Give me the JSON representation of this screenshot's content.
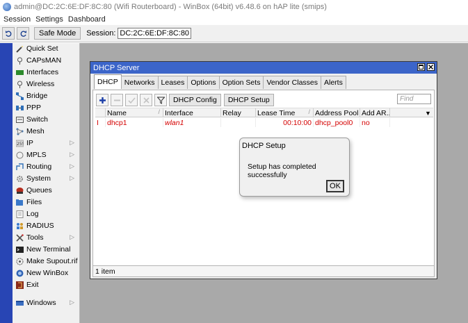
{
  "window": {
    "title": "admin@DC:2C:6E:DF:8C:80 (Wifi Routerboard) - WinBox (64bit) v6.48.6 on hAP lite (smips)"
  },
  "menubar": [
    "Session",
    "Settings",
    "Dashboard"
  ],
  "toolbar": {
    "undo_icon": "undo-icon",
    "redo_icon": "redo-icon",
    "safe_mode_label": "Safe Mode",
    "session_label": "Session:",
    "session_value": "DC:2C:6E:DF:8C:80"
  },
  "sidebar": {
    "items": [
      {
        "label": "Quick Set",
        "icon": "wand-icon",
        "submenu": false
      },
      {
        "label": "CAPsMAN",
        "icon": "antenna-icon",
        "submenu": false
      },
      {
        "label": "Interfaces",
        "icon": "interfaces-icon",
        "submenu": false
      },
      {
        "label": "Wireless",
        "icon": "wireless-icon",
        "submenu": false
      },
      {
        "label": "Bridge",
        "icon": "bridge-icon",
        "submenu": false
      },
      {
        "label": "PPP",
        "icon": "ppp-icon",
        "submenu": false
      },
      {
        "label": "Switch",
        "icon": "switch-icon",
        "submenu": false
      },
      {
        "label": "Mesh",
        "icon": "mesh-icon",
        "submenu": false
      },
      {
        "label": "IP",
        "icon": "ip-icon",
        "submenu": true
      },
      {
        "label": "MPLS",
        "icon": "mpls-icon",
        "submenu": true
      },
      {
        "label": "Routing",
        "icon": "routing-icon",
        "submenu": true
      },
      {
        "label": "System",
        "icon": "gear-icon",
        "submenu": true
      },
      {
        "label": "Queues",
        "icon": "queues-icon",
        "submenu": false
      },
      {
        "label": "Files",
        "icon": "folder-icon",
        "submenu": false
      },
      {
        "label": "Log",
        "icon": "log-icon",
        "submenu": false
      },
      {
        "label": "RADIUS",
        "icon": "users-icon",
        "submenu": false
      },
      {
        "label": "Tools",
        "icon": "tools-icon",
        "submenu": true
      },
      {
        "label": "New Terminal",
        "icon": "terminal-icon",
        "submenu": false
      },
      {
        "label": "Make Supout.rif",
        "icon": "supout-icon",
        "submenu": false
      },
      {
        "label": "New WinBox",
        "icon": "winbox-icon",
        "submenu": false
      },
      {
        "label": "Exit",
        "icon": "exit-icon",
        "submenu": false
      }
    ],
    "windows_item": {
      "label": "Windows",
      "icon": "windows-icon",
      "submenu": true
    }
  },
  "dhcp_window": {
    "title": "DHCP Server",
    "tabs": [
      "DHCP",
      "Networks",
      "Leases",
      "Options",
      "Option Sets",
      "Vendor Classes",
      "Alerts"
    ],
    "active_tab": "DHCP",
    "buttons": {
      "dhcp_config": "DHCP Config",
      "dhcp_setup": "DHCP Setup"
    },
    "find_placeholder": "Find",
    "columns": [
      "Name",
      "Interface",
      "Relay",
      "Lease Time",
      "Address Pool",
      "Add AR..."
    ],
    "rows": [
      {
        "flag": "I",
        "name": "dhcp1",
        "interface": "wlan1",
        "relay": "",
        "lease_time": "00:10:00",
        "address_pool": "dhcp_pool0",
        "add_arp": "no"
      }
    ],
    "status": "1 item",
    "row_color": "#d40000"
  },
  "dialog": {
    "title": "DHCP Setup",
    "message": "Setup has completed successfully",
    "ok_label": "OK"
  },
  "colors": {
    "title_bar": "#3c65c9",
    "desktop": "#a9a9a9",
    "left_strip": "#2845b4"
  }
}
